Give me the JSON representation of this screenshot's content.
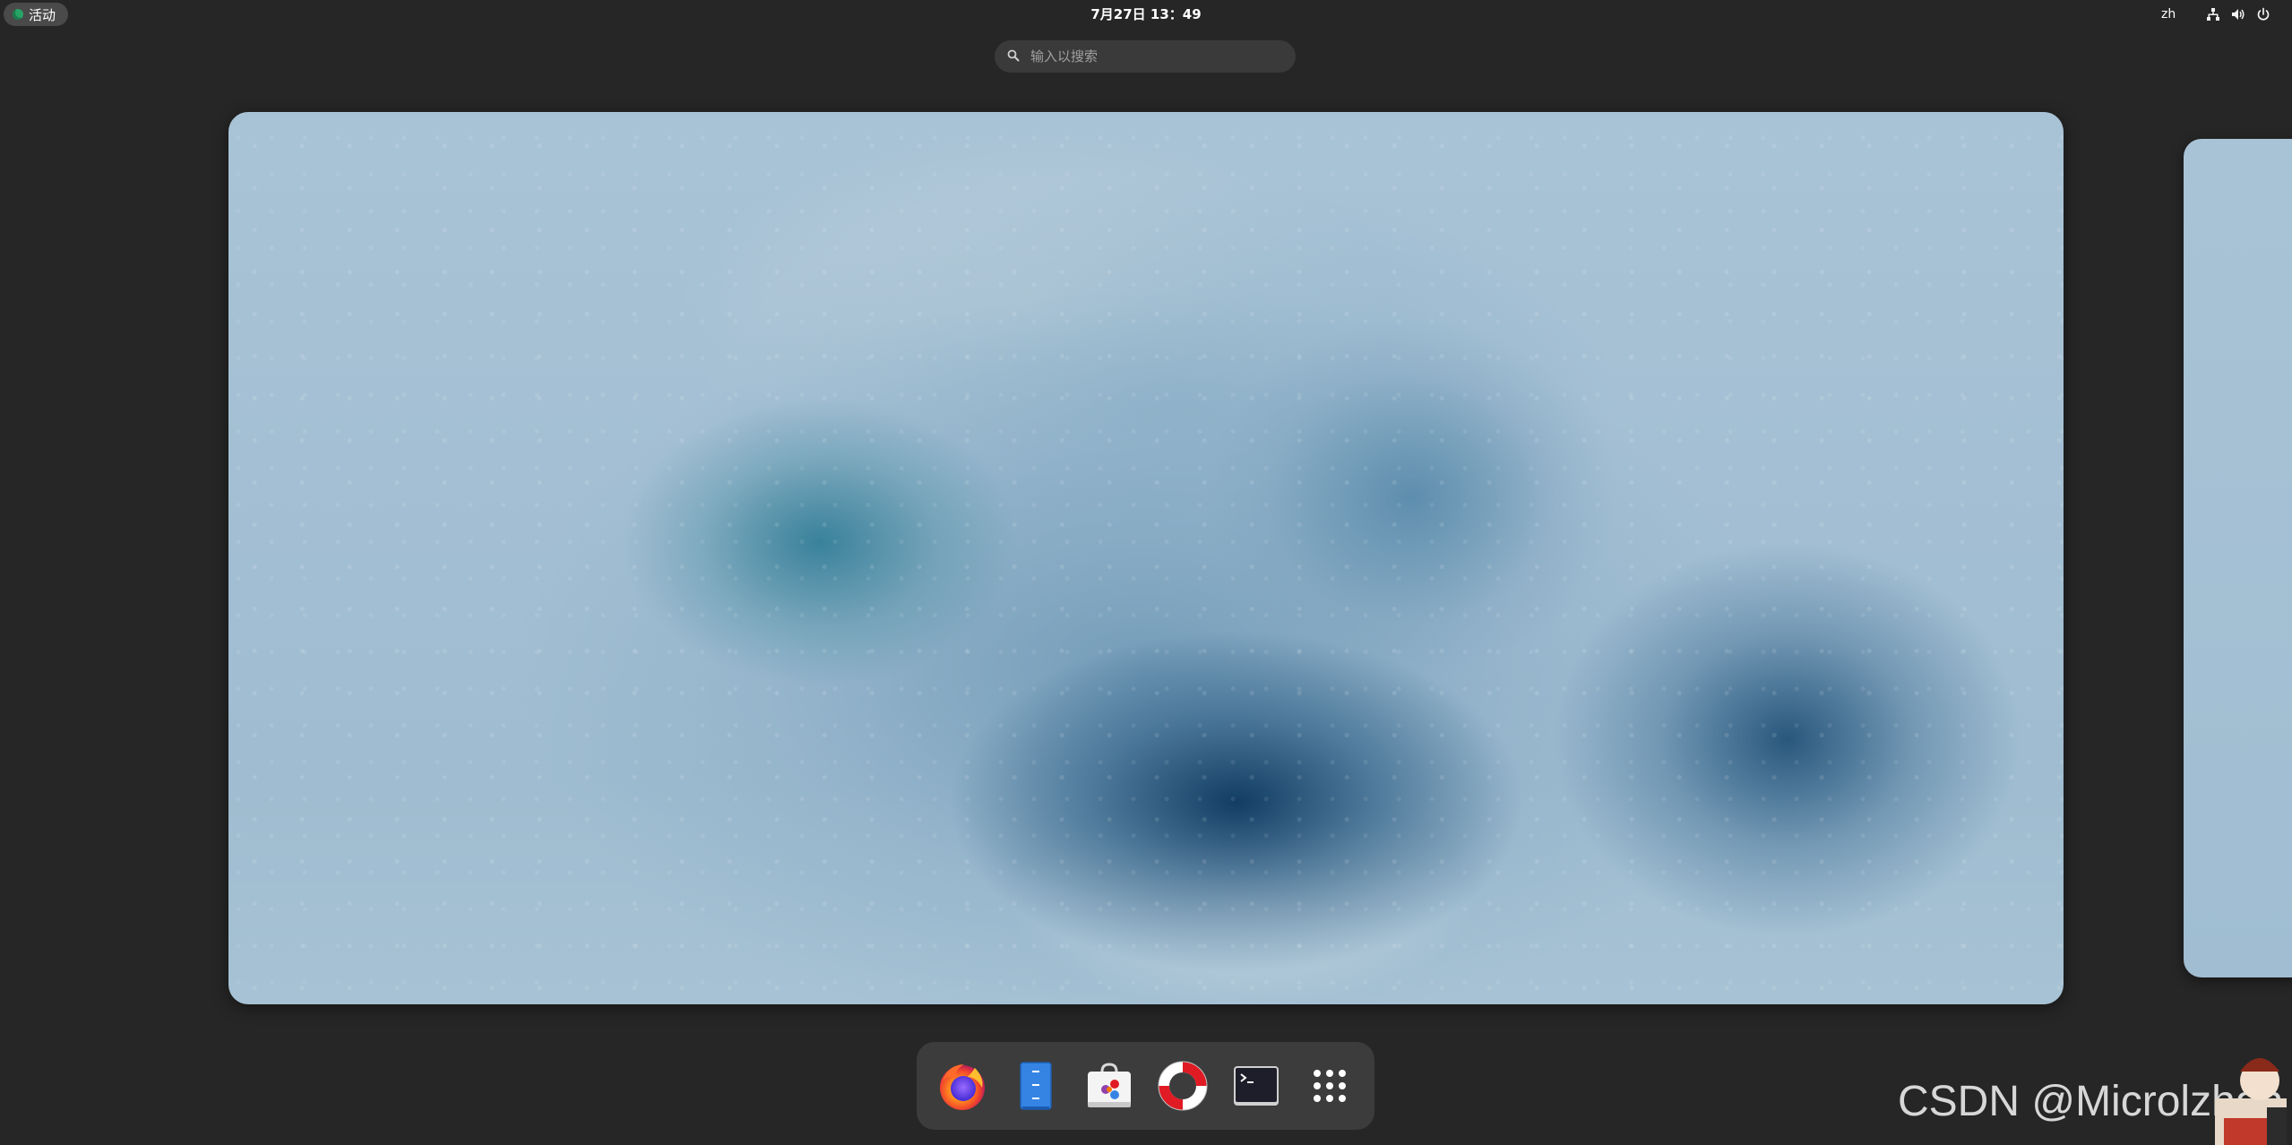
{
  "topbar": {
    "activities_label": "活动",
    "clock": "7月27日  13：49",
    "language": "zh",
    "tray_icons": [
      "network-wired-icon",
      "volume-icon",
      "power-icon"
    ]
  },
  "search": {
    "placeholder": "输入以搜索",
    "value": ""
  },
  "dash": {
    "items": [
      {
        "name": "Firefox",
        "icon": "firefox-icon"
      },
      {
        "name": "Files",
        "icon": "files-icon"
      },
      {
        "name": "Software",
        "icon": "software-store-icon"
      },
      {
        "name": "Help",
        "icon": "help-lifebuoy-icon"
      },
      {
        "name": "Terminal",
        "icon": "terminal-icon"
      },
      {
        "name": "Show Applications",
        "icon": "app-grid-icon"
      }
    ]
  },
  "watermark": {
    "text": "CSDN @Microlzhdh"
  },
  "colors": {
    "panel": "#262626",
    "dash": "#3c3c3c",
    "search": "#3a3a3a",
    "accent": "#27a365",
    "wallpaper_base": "#a4bfd3"
  }
}
